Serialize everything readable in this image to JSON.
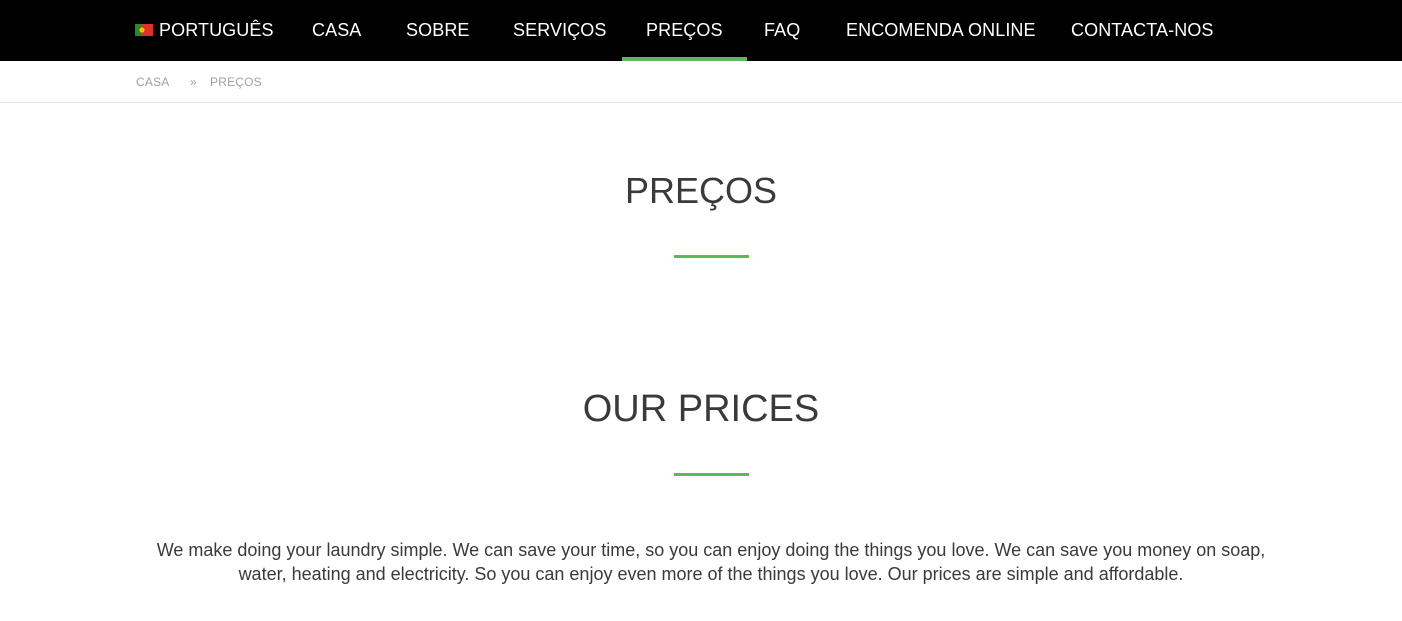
{
  "nav": {
    "language": "PORTUGUÊS",
    "items": [
      "CASA",
      "SOBRE",
      "SERVIÇOS",
      "PREÇOS",
      "FAQ",
      "ENCOMENDA ONLINE",
      "CONTACTA-NOS"
    ],
    "active": "PREÇOS",
    "accent": "#5cb85c"
  },
  "breadcrumb": {
    "home": "CASA",
    "separator": "»",
    "current": "PREÇOS"
  },
  "page": {
    "title": "PREÇOS",
    "section_title": "OUR PRICES",
    "intro": "We make doing your laundry simple. We can save your time, so you can enjoy doing the things you love. We can save you money on soap, water, heating and electricity. So you can enjoy even more of the things you love. Our prices are simple and affordable."
  },
  "icons": {
    "language_flag": "portugal-flag-icon"
  }
}
